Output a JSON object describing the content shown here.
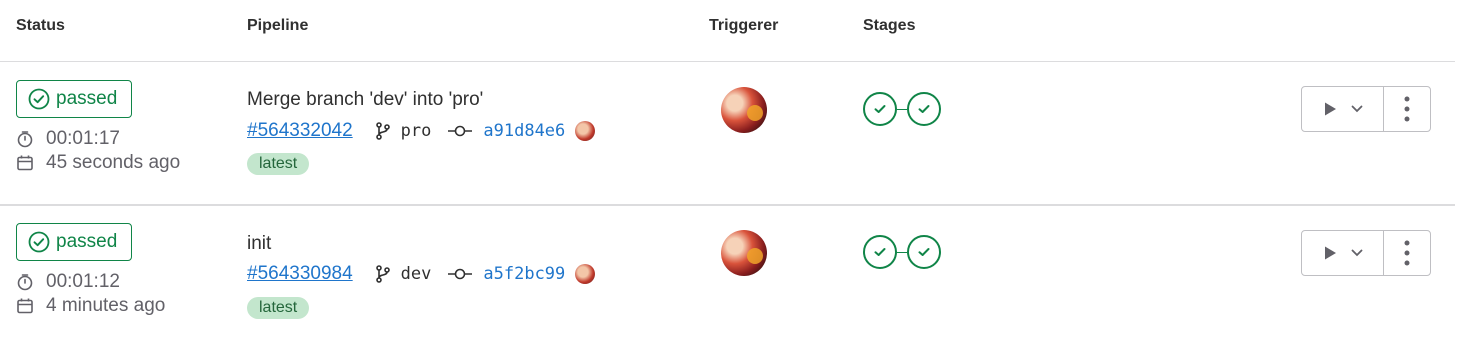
{
  "headers": {
    "status": "Status",
    "pipeline": "Pipeline",
    "triggerer": "Triggerer",
    "stages": "Stages"
  },
  "rows": [
    {
      "status": "passed",
      "duration": "00:01:17",
      "finished": "45 seconds ago",
      "commit_title": "Merge branch 'dev' into 'pro'",
      "pipeline_id": "#564332042",
      "ref": "pro",
      "sha": "a91d84e6",
      "badge": "latest"
    },
    {
      "status": "passed",
      "duration": "00:01:12",
      "finished": "4 minutes ago",
      "commit_title": "init",
      "pipeline_id": "#564330984",
      "ref": "dev",
      "sha": "a5f2bc99",
      "badge": "latest"
    }
  ],
  "colors": {
    "success": "#108548",
    "link": "#1f75cb",
    "latest_bg": "#c3e6cd"
  },
  "icons": [
    "status-success-icon",
    "timer-icon",
    "calendar-icon",
    "branch-icon",
    "commit-icon",
    "stage-success-icon",
    "play-icon",
    "chevron-down-icon",
    "more-actions-icon"
  ]
}
